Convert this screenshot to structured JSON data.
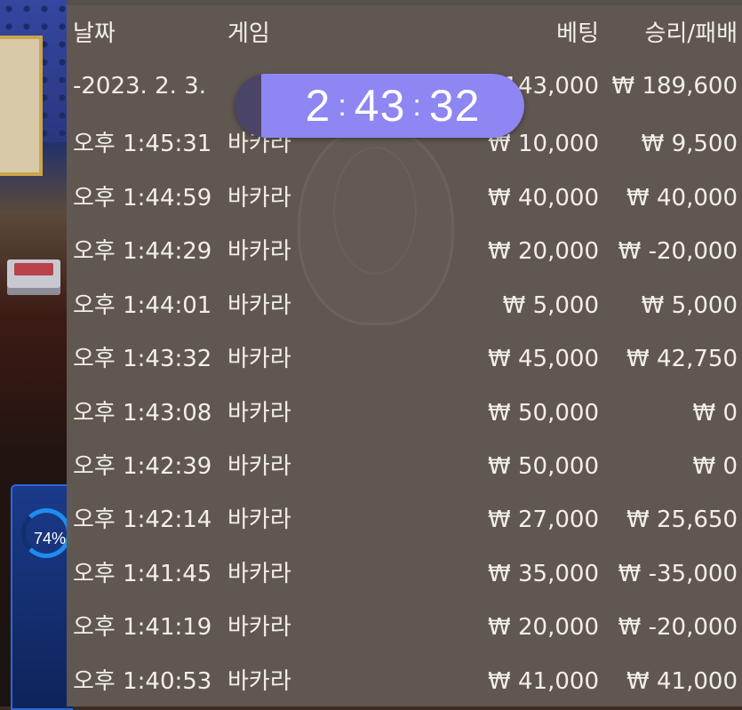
{
  "header": {
    "date": "날짜",
    "game": "게임",
    "bet": "베팅",
    "result": "승리/패배"
  },
  "summary": {
    "date": "-2023. 2. 3.",
    "bet": "₩ 143,000",
    "result": "₩ 189,600"
  },
  "timer": {
    "hours": "2",
    "minutes": "43",
    "seconds": "32"
  },
  "rows": [
    {
      "time": "오후 1:45:31",
      "game": "바카라",
      "bet": "₩ 10,000",
      "result": "₩ 9,500"
    },
    {
      "time": "오후 1:44:59",
      "game": "바카라",
      "bet": "₩ 40,000",
      "result": "₩ 40,000"
    },
    {
      "time": "오후 1:44:29",
      "game": "바카라",
      "bet": "₩ 20,000",
      "result": "₩ -20,000"
    },
    {
      "time": "오후 1:44:01",
      "game": "바카라",
      "bet": "₩ 5,000",
      "result": "₩ 5,000"
    },
    {
      "time": "오후 1:43:32",
      "game": "바카라",
      "bet": "₩ 45,000",
      "result": "₩ 42,750"
    },
    {
      "time": "오후 1:43:08",
      "game": "바카라",
      "bet": "₩ 50,000",
      "result": "₩ 0"
    },
    {
      "time": "오후 1:42:39",
      "game": "바카라",
      "bet": "₩ 50,000",
      "result": "₩ 0"
    },
    {
      "time": "오후 1:42:14",
      "game": "바카라",
      "bet": "₩ 27,000",
      "result": "₩ 25,650"
    },
    {
      "time": "오후 1:41:45",
      "game": "바카라",
      "bet": "₩ 35,000",
      "result": "₩ -35,000"
    },
    {
      "time": "오후 1:41:19",
      "game": "바카라",
      "bet": "₩ 20,000",
      "result": "₩ -20,000"
    },
    {
      "time": "오후 1:40:53",
      "game": "바카라",
      "bet": "₩ 41,000",
      "result": "₩ 41,000"
    }
  ],
  "background": {
    "progress_label": "74%",
    "progress": 0.74
  },
  "colors": {
    "overlay": "#625a52",
    "timer_fill": "#8e86f2",
    "timer_track": "#4a4468",
    "text": "#f2efea"
  }
}
